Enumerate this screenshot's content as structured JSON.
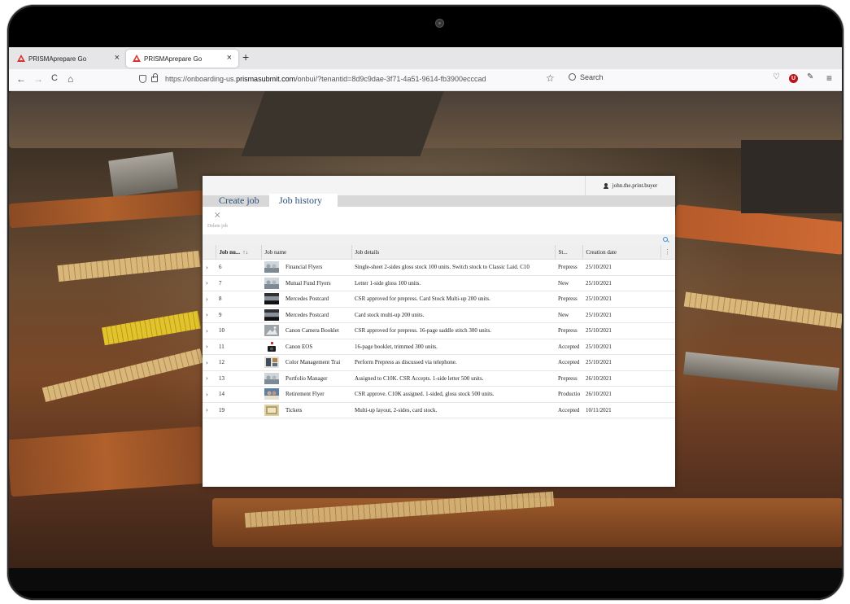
{
  "browser": {
    "tabs": [
      {
        "label": "PRISMAprepare Go",
        "active": false
      },
      {
        "label": "PRISMAprepare Go",
        "active": true
      }
    ],
    "new_tab_label": "+",
    "url_prefix": "https://onboarding-us.",
    "url_domain": "prismasubmit.com",
    "url_suffix": "/onbui/?tenantid=8d9c9dae-3f71-4a51-9614-fb3900ecccad",
    "search_placeholder": "Search",
    "nav": {
      "back": "←",
      "forward": "→",
      "reload": "C",
      "home": "⌂",
      "star": "☆",
      "menu": "≡"
    },
    "ublock_label": "U",
    "tab_close": "×"
  },
  "app": {
    "user": "john.the.print.buyer",
    "tabs": [
      "Create job",
      "Job history"
    ],
    "active_tab": "Job history",
    "delete_label": "Delete job",
    "delete_icon": "×",
    "columns": [
      "Job nu...",
      "Job name",
      "Job details",
      "St...",
      "Creation date"
    ],
    "sort_icon": "↑↓",
    "column_menu_icon": "⋮",
    "expand_icon": "›",
    "rows": [
      {
        "num": "6",
        "name": "Financial Flyers",
        "details": "Single-sheet 2-sides gloss stock 100 units. Switch stock to Classic Laid. C10",
        "status": "Prepress",
        "date": "25/10/2021",
        "thumb": "flyer"
      },
      {
        "num": "7",
        "name": "Mutual Fund Flyers",
        "details": "Letter 1-side gloss 100 units.",
        "status": "New",
        "date": "25/10/2021",
        "thumb": "flyer"
      },
      {
        "num": "8",
        "name": "Mercedes Postcard",
        "details": "CSR approved for prepress. Card Stock Multi-up 200 units.",
        "status": "Prepress",
        "date": "25/10/2021",
        "thumb": "car"
      },
      {
        "num": "9",
        "name": "Mercedes Postcard",
        "details": "Card stock multi-up 200 units.",
        "status": "New",
        "date": "25/10/2021",
        "thumb": "car"
      },
      {
        "num": "10",
        "name": "Canon Camera Booklet",
        "details": "CSR approved for prepress. 16-page saddle stitch 300 units.",
        "status": "Prepress",
        "date": "25/10/2021",
        "thumb": "placeholder"
      },
      {
        "num": "11",
        "name": "Canon EOS",
        "details": "16-page booklet, trimmed 300 units.",
        "status": "Accepted",
        "date": "25/10/2021",
        "thumb": "camera"
      },
      {
        "num": "12",
        "name": "Color Management Trai",
        "details": "Perform Prepress as discussed via telephone.",
        "status": "Accepted",
        "date": "25/10/2021",
        "thumb": "color"
      },
      {
        "num": "13",
        "name": "Portfolio Manager",
        "details": "Assigned to C10K. CSR Accepts. 1-side letter 500 units.",
        "status": "Prepress",
        "date": "26/10/2021",
        "thumb": "flyer"
      },
      {
        "num": "14",
        "name": "Retirement Flyer",
        "details": "CSR approve. C10K assigned. 1-sided, gloss stock 500 units.",
        "status": "Productio",
        "date": "26/10/2021",
        "thumb": "people"
      },
      {
        "num": "19",
        "name": "Tickets",
        "details": "Multi-up layout, 2-sides, card stock.",
        "status": "Accepted",
        "date": "10/11/2021",
        "thumb": "ticket"
      }
    ]
  },
  "colors": {
    "tab_link": "#2a4f7a",
    "accent_blue": "#3a8dd8",
    "firefox_logo": "#d9342b",
    "ublock": "#b8141a"
  }
}
